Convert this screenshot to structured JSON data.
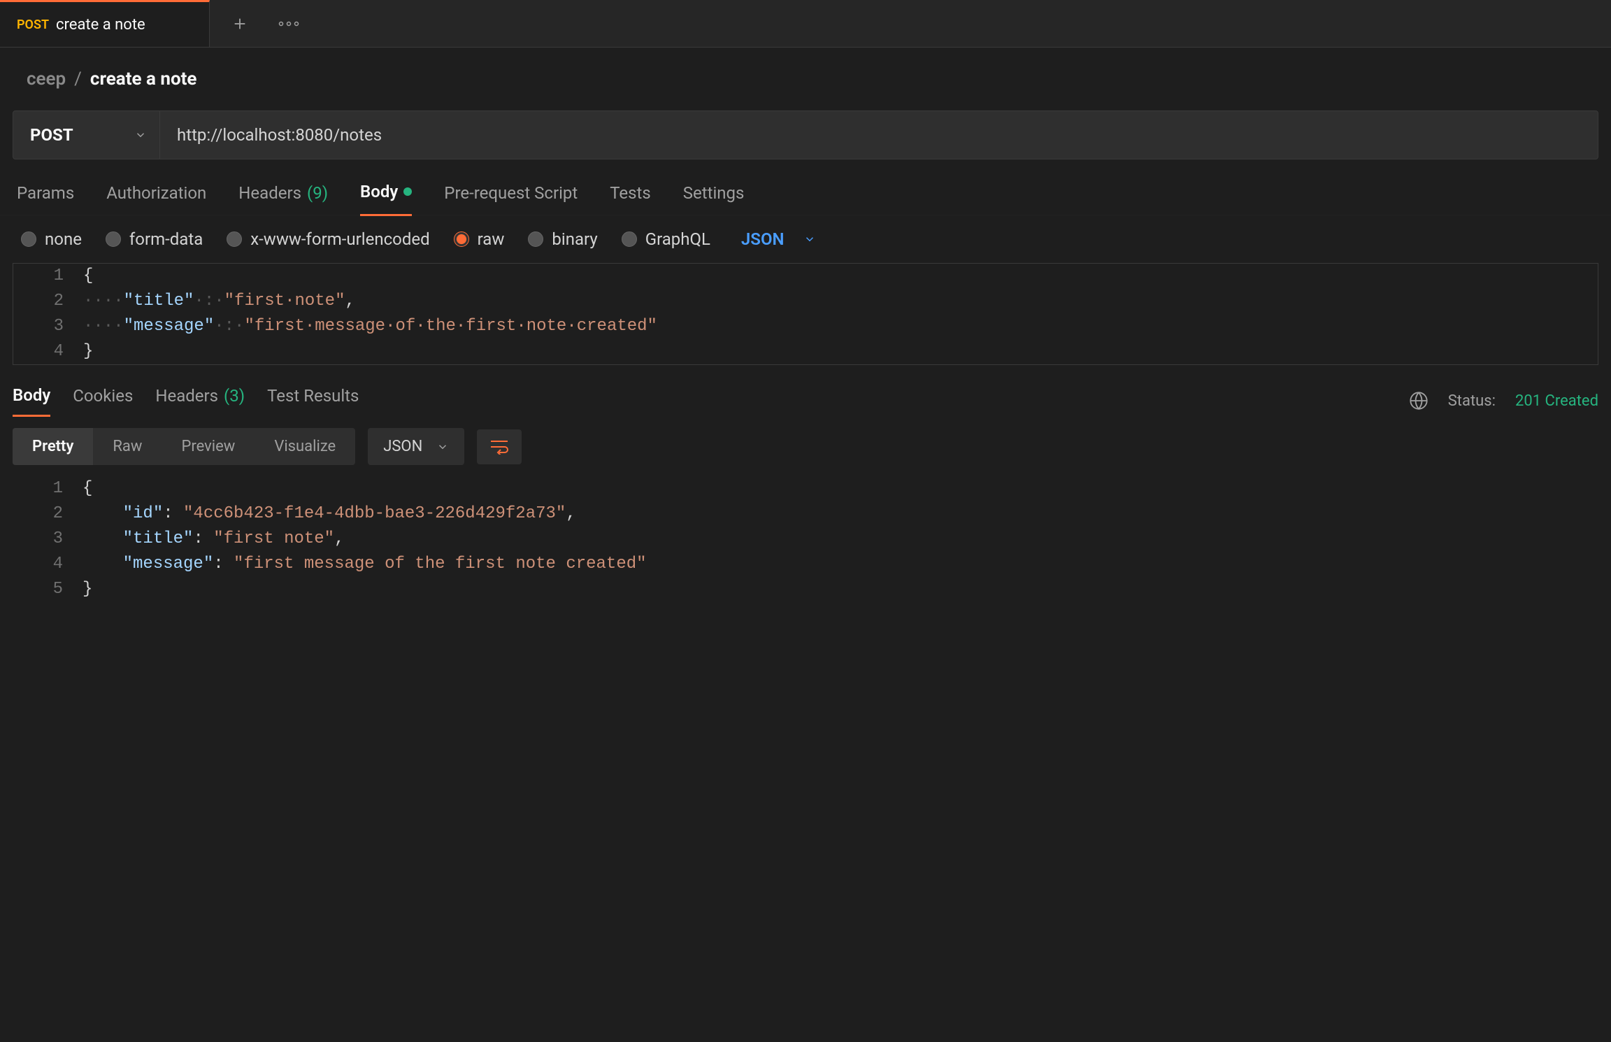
{
  "tab": {
    "method": "POST",
    "label": "create a note"
  },
  "breadcrumb": {
    "folder": "ceep",
    "sep": "/",
    "name": "create a note"
  },
  "request": {
    "method": "POST",
    "url": "http://localhost:8080/notes"
  },
  "request_tabs": {
    "params": "Params",
    "authorization": "Authorization",
    "headers": "Headers",
    "headers_count": "(9)",
    "body": "Body",
    "prerequest": "Pre-request Script",
    "tests": "Tests",
    "settings": "Settings"
  },
  "body_type": {
    "none": "none",
    "formdata": "form-data",
    "urlencoded": "x-www-form-urlencoded",
    "raw": "raw",
    "binary": "binary",
    "graphql": "GraphQL",
    "format": "JSON"
  },
  "request_body": {
    "l1": "{",
    "l2_ws": "····",
    "l2_key": "\"title\"",
    "l2_colon": "·:·",
    "l2_val": "\"first·note\"",
    "l2_comma": ",",
    "l3_ws": "····",
    "l3_key": "\"message\"",
    "l3_colon": "·:·",
    "l3_val": "\"first·message·of·the·first·note·created\"",
    "l4": "}",
    "gutter": [
      "1",
      "2",
      "3",
      "4"
    ]
  },
  "response_tabs": {
    "body": "Body",
    "cookies": "Cookies",
    "headers": "Headers",
    "headers_count": "(3)",
    "test_results": "Test Results"
  },
  "response_status": {
    "status_label": "Status:",
    "status_value": "201 Created"
  },
  "view_mode": {
    "pretty": "Pretty",
    "raw": "Raw",
    "preview": "Preview",
    "visualize": "Visualize",
    "format": "JSON"
  },
  "response_body": {
    "gutter": [
      "1",
      "2",
      "3",
      "4",
      "5"
    ],
    "l1": "{",
    "l2_ws": "    ",
    "l2_key": "\"id\"",
    "l2_colon": ": ",
    "l2_val": "\"4cc6b423-f1e4-4dbb-bae3-226d429f2a73\"",
    "l2_comma": ",",
    "l3_ws": "    ",
    "l3_key": "\"title\"",
    "l3_colon": ": ",
    "l3_val": "\"first note\"",
    "l3_comma": ",",
    "l4_ws": "    ",
    "l4_key": "\"message\"",
    "l4_colon": ": ",
    "l4_val": "\"first message of the first note created\"",
    "l5": "}"
  }
}
